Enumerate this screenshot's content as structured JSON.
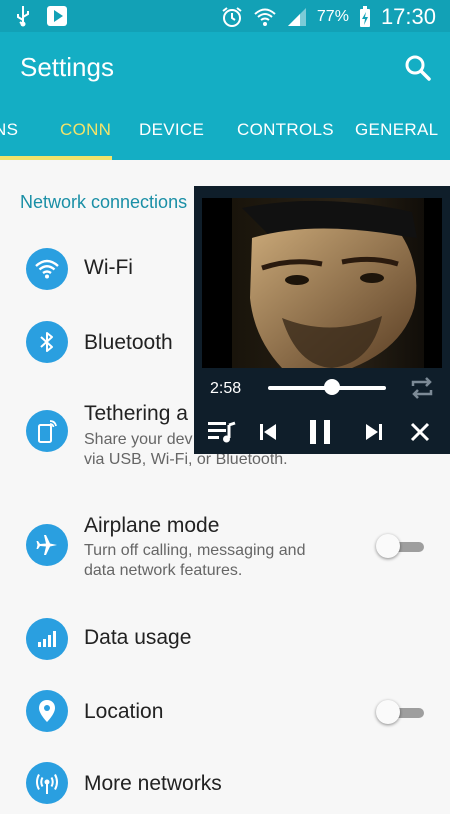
{
  "status_bar": {
    "battery": "77%",
    "time": "17:30"
  },
  "app_bar": {
    "title": "Settings"
  },
  "tabs": [
    "NS",
    "CONN",
    "DEVICE",
    "CONTROLS",
    "GENERAL"
  ],
  "section": {
    "header": "Network connections"
  },
  "items": [
    {
      "title": "Wi-Fi"
    },
    {
      "title": "Bluetooth"
    },
    {
      "title": "Tethering a",
      "subtitle_line1": "Share your dev",
      "subtitle_line2": "via USB, Wi-Fi, or Bluetooth."
    },
    {
      "title": "Airplane mode",
      "subtitle_line1": "Turn off calling, messaging and",
      "subtitle_line2": "data network features.",
      "toggle_on": false
    },
    {
      "title": "Data usage"
    },
    {
      "title": "Location",
      "toggle_on": false
    },
    {
      "title": "More networks"
    }
  ],
  "player": {
    "elapsed": "2:58",
    "progress": 0.55
  },
  "colors": {
    "accent": "#14aec4",
    "tab_active": "#f2e36b",
    "icon_bg": "#2a9fe0",
    "section_header": "#1a8fa6"
  }
}
